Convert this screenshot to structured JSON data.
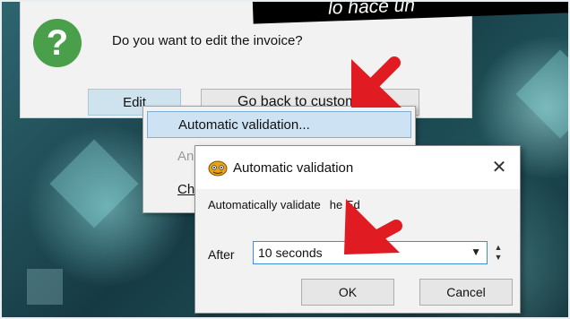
{
  "banner": {
    "text": "lo hace un"
  },
  "main_dialog": {
    "question": "Do you want to edit the invoice?",
    "icon": "question-icon",
    "edit_button": "Edit",
    "back_button": "Go back to custom"
  },
  "context_menu": {
    "items": [
      {
        "label": "Automatic validation...",
        "state": "selected"
      },
      {
        "label": "An",
        "state": "disabled"
      },
      {
        "label": "Ch",
        "state": "normal"
      }
    ]
  },
  "auto_dialog": {
    "title": "Automatic validation",
    "close_icon": "close-icon",
    "description": "Automatically validate",
    "description_tail": "he Ed",
    "after_label": "After",
    "select_value": "10 seconds",
    "ok_label": "OK",
    "cancel_label": "Cancel"
  },
  "colors": {
    "arrow_red": "#e11b22",
    "question_green": "#4aa04a",
    "selection_blue": "#cde3f3"
  }
}
